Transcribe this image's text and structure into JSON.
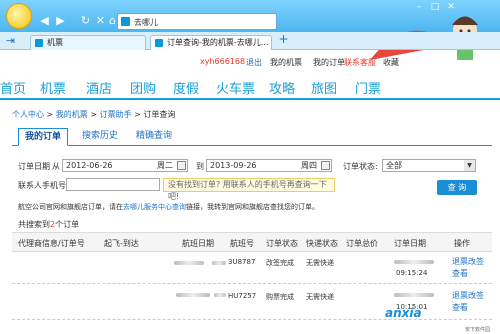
{
  "browser": {
    "url_text": "去哪儿",
    "tabs": [
      {
        "label": "机票"
      },
      {
        "label": "订单查询-我的机票-去哪儿..."
      }
    ],
    "new_tab": "+"
  },
  "topbar": {
    "username": "xyh666168",
    "logout": "退出",
    "my_ticket": "我的机票",
    "my_order": "我的订单",
    "service": "联系客服",
    "favorite": "收藏"
  },
  "menu": [
    "首页",
    "机票",
    "酒店",
    "团购",
    "度假",
    "火车票",
    "攻略",
    "旅图",
    "门票"
  ],
  "breadcrumb": {
    "items": [
      "个人中心",
      "我的机票",
      "订票助手",
      "订单查询"
    ],
    "sep": ">"
  },
  "subtabs": [
    "我的订单",
    "搜索历史",
    "精确查询"
  ],
  "form": {
    "date_label": "订单日期",
    "from_label": "从",
    "from_value": "2012-06-26",
    "from_weekday": "周二",
    "to_label": "到",
    "to_value": "2013-09-26",
    "to_weekday": "周四",
    "status_label": "订单状态:",
    "status_value": "全部",
    "phone_label": "联系人手机号",
    "tip": "没有找到订单? 用联系人的手机号再查询一下吧!",
    "query_button": "查 询"
  },
  "note": {
    "before": "航空公司官网和旗舰店订单，请在",
    "link": "去哪儿服务中心查询",
    "after": "链接，我转到官网和旗舰店查找您的订单。"
  },
  "result": {
    "prefix": "共搜索到",
    "count": "2",
    "suffix": "个订单"
  },
  "table": {
    "headers": [
      "代理商信息/订单号",
      "起飞-到达",
      "航班日期",
      "航班号",
      "订单状态",
      "快递状态",
      "订单总价",
      "订单日期",
      "操作"
    ],
    "rows": [
      {
        "flight_no": "3U8787",
        "status": "改签完成",
        "express": "无需快递",
        "time": "09:15:24",
        "ops": [
          "退票改签",
          "查看"
        ]
      },
      {
        "flight_no": "HU7257",
        "status": "购票完成",
        "express": "无需快递",
        "time": "10:15:01",
        "ops": [
          "退票改签",
          "查看"
        ]
      }
    ]
  },
  "watermark": {
    "text": "anxia",
    "sub": "安下软件园"
  }
}
